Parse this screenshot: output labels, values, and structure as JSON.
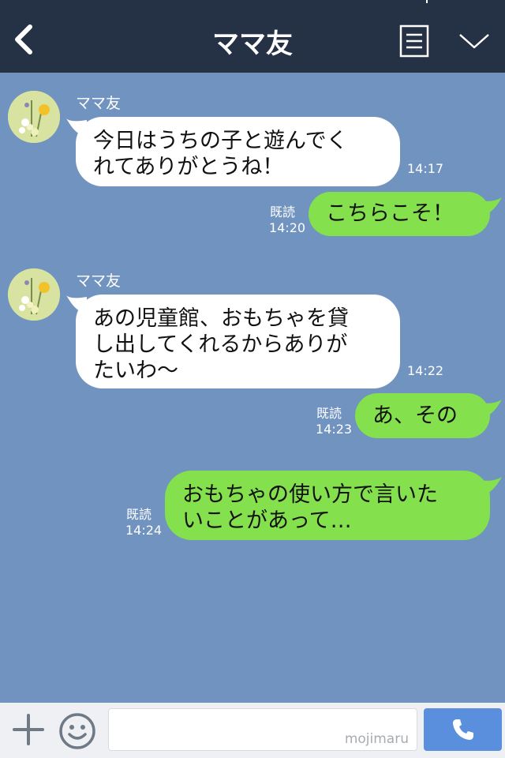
{
  "header": {
    "title": "ママ友",
    "back_icon": "back-chevron-icon",
    "menu_icon": "notes-menu-icon",
    "expand_icon": "chevron-down-icon",
    "background": "#253145"
  },
  "chat": {
    "background": "#7093c0",
    "messages": [
      {
        "direction": "in",
        "sender": "ママ友",
        "text_lines": [
          "今日はうちの子と遊んでく",
          "れてありがとうね！"
        ],
        "time": "14:17"
      },
      {
        "direction": "out",
        "read": "既読",
        "time": "14:20",
        "text": "こちらこそ！"
      },
      {
        "direction": "in",
        "sender": "ママ友",
        "text_lines": [
          "あの児童館、おもちゃを貸",
          "し出してくれるからありが",
          "たいわ〜"
        ],
        "time": "14:22"
      },
      {
        "direction": "out",
        "read": "既読",
        "time": "14:23",
        "text": "あ、その"
      },
      {
        "direction": "out",
        "read": "既読",
        "time": "14:24",
        "text_lines": [
          "おもちゃの使い方で言いた",
          "いことがあって…"
        ]
      }
    ],
    "incoming_bubble_color": "#ffffff",
    "outgoing_bubble_color": "#84e04c"
  },
  "input_bar": {
    "plus_icon": "plus-icon",
    "sticker_icon": "smiley-icon",
    "watermark": "mojimaru",
    "call_icon": "phone-icon",
    "call_button_color": "#5a8fde"
  }
}
